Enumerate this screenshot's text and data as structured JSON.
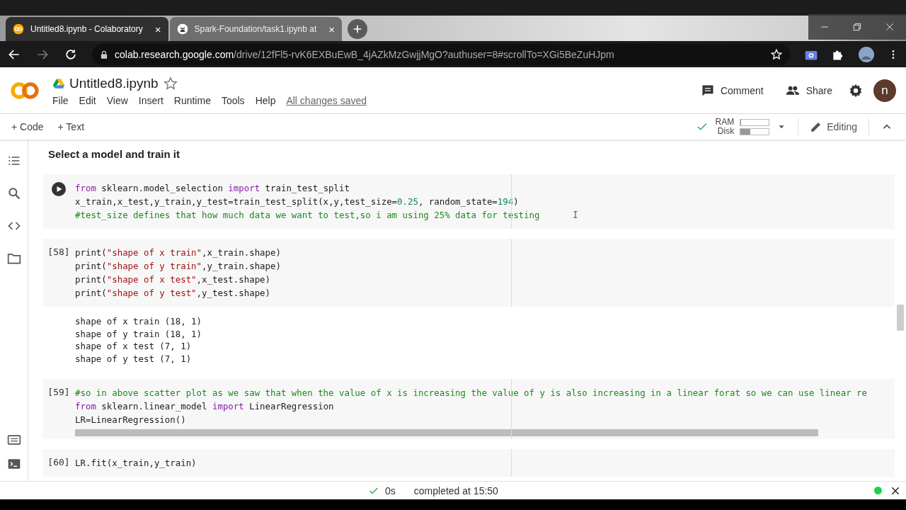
{
  "browser": {
    "tabs": [
      {
        "title": "Untitled8.ipynb - Colaboratory",
        "close": "×",
        "selected": true
      },
      {
        "title": "Spark-Foundation/task1.ipynb at",
        "close": "×",
        "selected": false
      }
    ],
    "url_host": "colab.research.google.com",
    "url_path": "/drive/12fFl5-rvK6EXBuEwB_4jAZkMzGwjjMgO?authuser=8#scrollTo=XGi5BeZuHJpm"
  },
  "header": {
    "notebook_title": "Untitled8.ipynb",
    "menu": [
      "File",
      "Edit",
      "View",
      "Insert",
      "Runtime",
      "Tools",
      "Help"
    ],
    "save_status": "All changes saved",
    "comment": "Comment",
    "share": "Share",
    "avatar": "n"
  },
  "toolbar": {
    "add_code": "+ Code",
    "add_text": "+ Text",
    "ram_label": "RAM",
    "ram": {
      "level": 0.03
    },
    "disk_label": "Disk",
    "disk": {
      "level": 0.35
    },
    "mode": "Editing"
  },
  "section_heading": "Select a model and train it",
  "cells": [
    {
      "lines": [
        [
          {
            "t": "from",
            "kind": "kw"
          },
          {
            "t": " sklearn.model_selection ",
            "kind": "plain"
          },
          {
            "t": "import",
            "kind": "kw"
          },
          {
            "t": " train_test_split",
            "kind": "plain"
          }
        ],
        [
          {
            "t": "x_train,x_test,y_train,y_test=train_test_split(x,y,test_size=",
            "kind": "plain"
          },
          {
            "t": "0.25",
            "kind": "num"
          },
          {
            "t": ", random_state=",
            "kind": "plain"
          },
          {
            "t": "194",
            "kind": "num"
          },
          {
            "t": ")",
            "kind": "plain"
          }
        ],
        [
          {
            "t": "#test_size defines that how much data we want to test,so i am using 25% data for testing",
            "kind": "comment"
          }
        ]
      ]
    },
    {
      "count": "[58]",
      "lines": [
        [
          {
            "t": "print(",
            "kind": "plain"
          },
          {
            "t": "\"shape of x train\"",
            "kind": "str"
          },
          {
            "t": ",x_train.shape)",
            "kind": "plain"
          }
        ],
        [
          {
            "t": "print(",
            "kind": "plain"
          },
          {
            "t": "\"shape of y train\"",
            "kind": "str"
          },
          {
            "t": ",y_train.shape)",
            "kind": "plain"
          }
        ],
        [
          {
            "t": "print(",
            "kind": "plain"
          },
          {
            "t": "\"shape of x test\"",
            "kind": "str"
          },
          {
            "t": ",x_test.shape)",
            "kind": "plain"
          }
        ],
        [
          {
            "t": "print(",
            "kind": "plain"
          },
          {
            "t": "\"shape of y test\"",
            "kind": "str"
          },
          {
            "t": ",y_test.shape)",
            "kind": "plain"
          }
        ]
      ],
      "output": [
        "shape of x train (18, 1)",
        "shape of y train (18, 1)",
        "shape of x test (7, 1)",
        "shape of y test (7, 1)"
      ]
    },
    {
      "count": "[59]",
      "lines": [
        [
          {
            "t": "#so in above scatter plot as we saw that when the value of x is increasing the value of y is also increasing in a linear forat so we can use linear re",
            "kind": "comment"
          }
        ],
        [
          {
            "t": "from",
            "kind": "kw"
          },
          {
            "t": " sklearn.linear_model ",
            "kind": "plain"
          },
          {
            "t": "import",
            "kind": "kw"
          },
          {
            "t": " LinearRegression",
            "kind": "plain"
          }
        ],
        [
          {
            "t": "LR=LinearRegression()",
            "kind": "plain"
          }
        ]
      ],
      "scrollbar": true
    },
    {
      "count": "[60]",
      "lines": [
        [
          {
            "t": "LR.fit(x_train,y_train)",
            "kind": "plain"
          }
        ]
      ]
    }
  ],
  "status": {
    "duration": "0s",
    "completed": "completed at 15:50"
  }
}
